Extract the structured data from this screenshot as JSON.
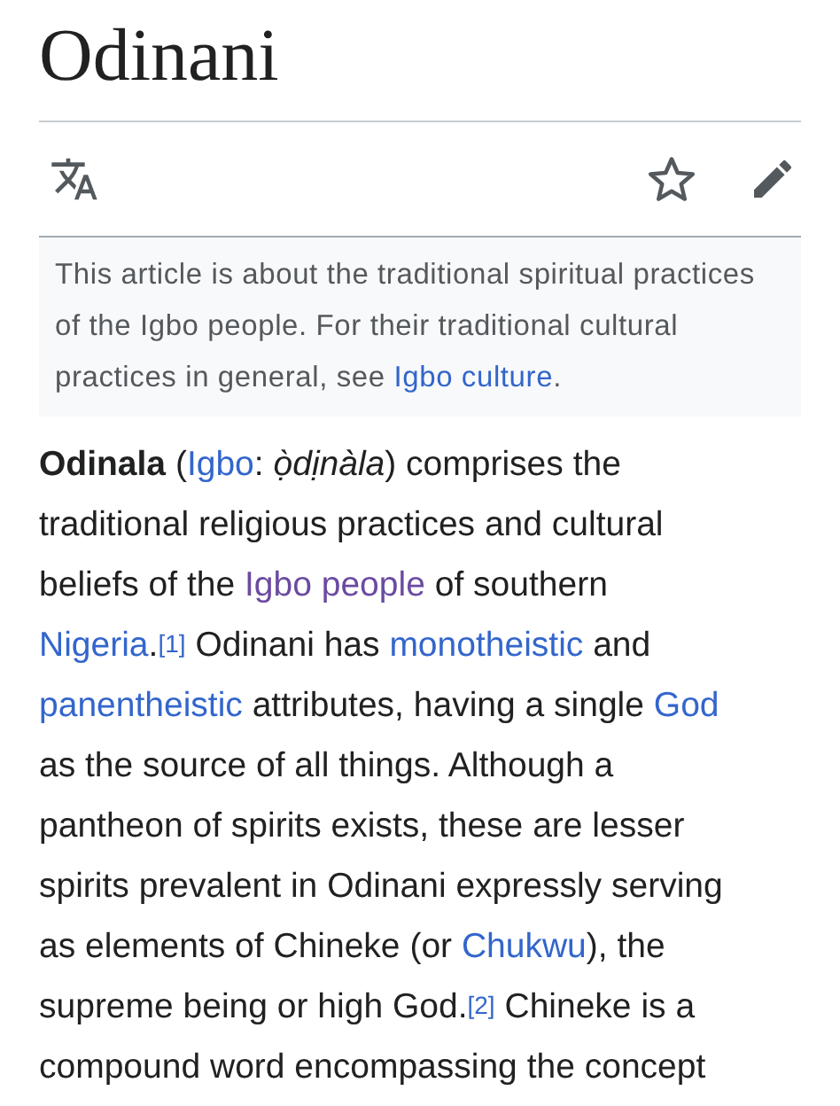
{
  "title": "Odinani",
  "toolbar": {
    "watch": {
      "on": false
    }
  },
  "hatnote": [
    {
      "kind": "text",
      "text": "This article is about the traditional spiritual practices of the Igbo people. For their traditional cultural practices in general, see "
    },
    {
      "kind": "link",
      "text": "Igbo culture",
      "visited": false
    },
    {
      "kind": "text",
      "text": "."
    }
  ],
  "paragraph": [
    {
      "kind": "bold",
      "text": "Odinala"
    },
    {
      "kind": "text",
      "text": " ("
    },
    {
      "kind": "link",
      "text": "Igbo",
      "visited": false
    },
    {
      "kind": "text",
      "text": ": "
    },
    {
      "kind": "italic",
      "text": "ọ̀dịnàla"
    },
    {
      "kind": "text",
      "text": ") comprises the\ntraditional religious practices and cultural\nbeliefs of the "
    },
    {
      "kind": "link",
      "text": "Igbo people",
      "visited": true
    },
    {
      "kind": "text",
      "text": " of southern\n"
    },
    {
      "kind": "link",
      "text": "Nigeria",
      "visited": false
    },
    {
      "kind": "text",
      "text": "."
    },
    {
      "kind": "ref",
      "text": "[1]"
    },
    {
      "kind": "text",
      "text": " Odinani has "
    },
    {
      "kind": "link",
      "text": "monotheistic",
      "visited": false
    },
    {
      "kind": "text",
      "text": " and\n"
    },
    {
      "kind": "link",
      "text": "panentheistic",
      "visited": false
    },
    {
      "kind": "text",
      "text": " attributes, having a single "
    },
    {
      "kind": "link",
      "text": "God",
      "visited": false
    },
    {
      "kind": "text",
      "text": "\nas the source of all things. Although a\npantheon of spirits exists, these are lesser\nspirits prevalent in Odinani expressly serving\nas elements of Chineke (or "
    },
    {
      "kind": "link",
      "text": "Chukwu",
      "visited": false
    },
    {
      "kind": "text",
      "text": "), the\nsupreme being or high God."
    },
    {
      "kind": "ref",
      "text": "[2]"
    },
    {
      "kind": "text",
      "text": " Chineke is a\ncompound word encompassing the concept"
    }
  ]
}
